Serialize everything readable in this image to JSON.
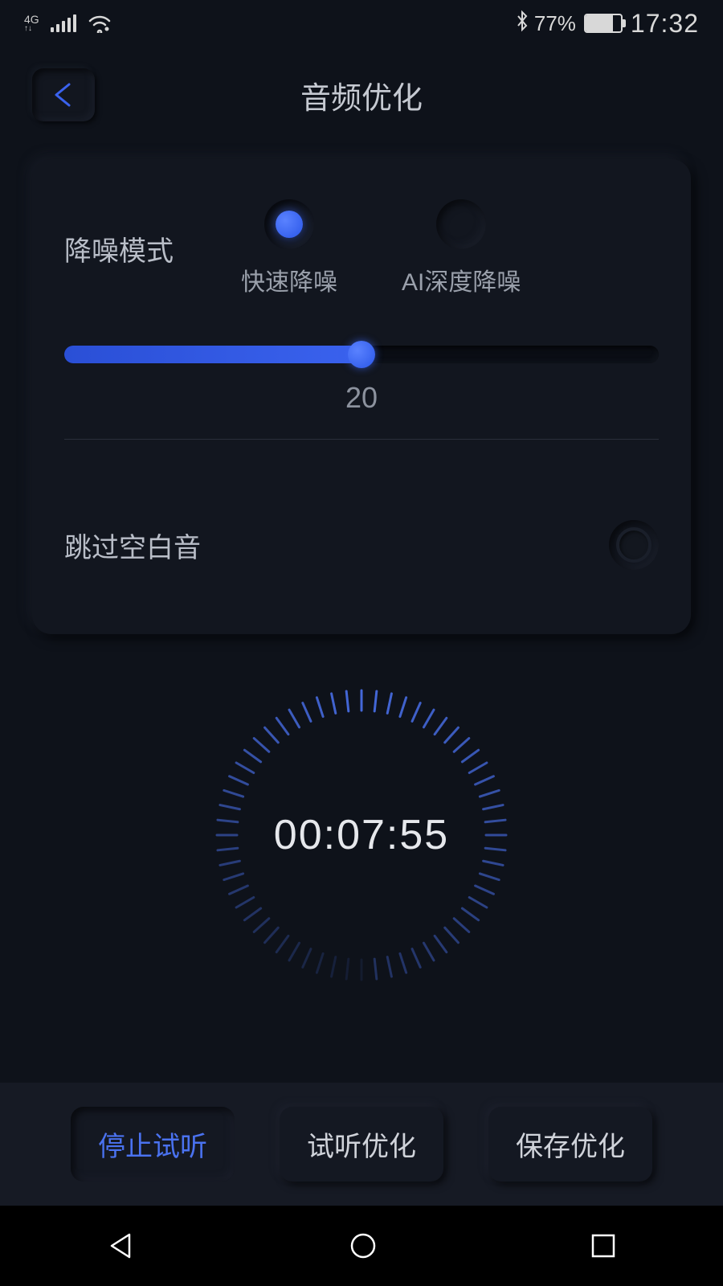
{
  "status": {
    "network": "4G",
    "battery_percent": "77%",
    "battery_fill": 77,
    "time": "17:32"
  },
  "header": {
    "title": "音频优化"
  },
  "noise": {
    "label": "降噪模式",
    "options": [
      {
        "label": "快速降噪",
        "selected": true
      },
      {
        "label": "AI深度降噪",
        "selected": false
      }
    ],
    "slider_value": "20",
    "slider_percent": 50
  },
  "skip": {
    "label": "跳过空白音",
    "enabled": false
  },
  "timer": {
    "display": "00:07:55"
  },
  "buttons": {
    "stop": "停止试听",
    "preview": "试听优化",
    "save": "保存优化"
  }
}
